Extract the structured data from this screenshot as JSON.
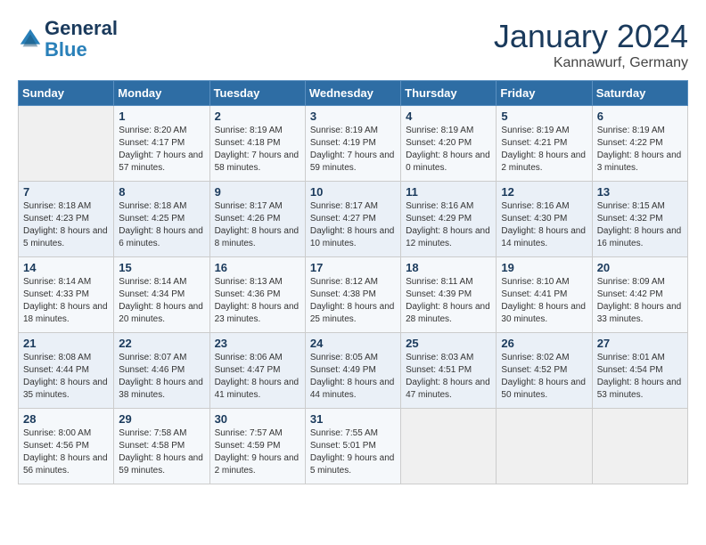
{
  "header": {
    "logo_line1": "General",
    "logo_line2": "Blue",
    "month_year": "January 2024",
    "location": "Kannawurf, Germany"
  },
  "days_of_week": [
    "Sunday",
    "Monday",
    "Tuesday",
    "Wednesday",
    "Thursday",
    "Friday",
    "Saturday"
  ],
  "weeks": [
    [
      {
        "day": "",
        "empty": true
      },
      {
        "day": "1",
        "sunrise": "8:20 AM",
        "sunset": "4:17 PM",
        "daylight": "7 hours and 57 minutes."
      },
      {
        "day": "2",
        "sunrise": "8:19 AM",
        "sunset": "4:18 PM",
        "daylight": "7 hours and 58 minutes."
      },
      {
        "day": "3",
        "sunrise": "8:19 AM",
        "sunset": "4:19 PM",
        "daylight": "7 hours and 59 minutes."
      },
      {
        "day": "4",
        "sunrise": "8:19 AM",
        "sunset": "4:20 PM",
        "daylight": "8 hours and 0 minutes."
      },
      {
        "day": "5",
        "sunrise": "8:19 AM",
        "sunset": "4:21 PM",
        "daylight": "8 hours and 2 minutes."
      },
      {
        "day": "6",
        "sunrise": "8:19 AM",
        "sunset": "4:22 PM",
        "daylight": "8 hours and 3 minutes."
      }
    ],
    [
      {
        "day": "7",
        "sunrise": "8:18 AM",
        "sunset": "4:23 PM",
        "daylight": "8 hours and 5 minutes."
      },
      {
        "day": "8",
        "sunrise": "8:18 AM",
        "sunset": "4:25 PM",
        "daylight": "8 hours and 6 minutes."
      },
      {
        "day": "9",
        "sunrise": "8:17 AM",
        "sunset": "4:26 PM",
        "daylight": "8 hours and 8 minutes."
      },
      {
        "day": "10",
        "sunrise": "8:17 AM",
        "sunset": "4:27 PM",
        "daylight": "8 hours and 10 minutes."
      },
      {
        "day": "11",
        "sunrise": "8:16 AM",
        "sunset": "4:29 PM",
        "daylight": "8 hours and 12 minutes."
      },
      {
        "day": "12",
        "sunrise": "8:16 AM",
        "sunset": "4:30 PM",
        "daylight": "8 hours and 14 minutes."
      },
      {
        "day": "13",
        "sunrise": "8:15 AM",
        "sunset": "4:32 PM",
        "daylight": "8 hours and 16 minutes."
      }
    ],
    [
      {
        "day": "14",
        "sunrise": "8:14 AM",
        "sunset": "4:33 PM",
        "daylight": "8 hours and 18 minutes."
      },
      {
        "day": "15",
        "sunrise": "8:14 AM",
        "sunset": "4:34 PM",
        "daylight": "8 hours and 20 minutes."
      },
      {
        "day": "16",
        "sunrise": "8:13 AM",
        "sunset": "4:36 PM",
        "daylight": "8 hours and 23 minutes."
      },
      {
        "day": "17",
        "sunrise": "8:12 AM",
        "sunset": "4:38 PM",
        "daylight": "8 hours and 25 minutes."
      },
      {
        "day": "18",
        "sunrise": "8:11 AM",
        "sunset": "4:39 PM",
        "daylight": "8 hours and 28 minutes."
      },
      {
        "day": "19",
        "sunrise": "8:10 AM",
        "sunset": "4:41 PM",
        "daylight": "8 hours and 30 minutes."
      },
      {
        "day": "20",
        "sunrise": "8:09 AM",
        "sunset": "4:42 PM",
        "daylight": "8 hours and 33 minutes."
      }
    ],
    [
      {
        "day": "21",
        "sunrise": "8:08 AM",
        "sunset": "4:44 PM",
        "daylight": "8 hours and 35 minutes."
      },
      {
        "day": "22",
        "sunrise": "8:07 AM",
        "sunset": "4:46 PM",
        "daylight": "8 hours and 38 minutes."
      },
      {
        "day": "23",
        "sunrise": "8:06 AM",
        "sunset": "4:47 PM",
        "daylight": "8 hours and 41 minutes."
      },
      {
        "day": "24",
        "sunrise": "8:05 AM",
        "sunset": "4:49 PM",
        "daylight": "8 hours and 44 minutes."
      },
      {
        "day": "25",
        "sunrise": "8:03 AM",
        "sunset": "4:51 PM",
        "daylight": "8 hours and 47 minutes."
      },
      {
        "day": "26",
        "sunrise": "8:02 AM",
        "sunset": "4:52 PM",
        "daylight": "8 hours and 50 minutes."
      },
      {
        "day": "27",
        "sunrise": "8:01 AM",
        "sunset": "4:54 PM",
        "daylight": "8 hours and 53 minutes."
      }
    ],
    [
      {
        "day": "28",
        "sunrise": "8:00 AM",
        "sunset": "4:56 PM",
        "daylight": "8 hours and 56 minutes."
      },
      {
        "day": "29",
        "sunrise": "7:58 AM",
        "sunset": "4:58 PM",
        "daylight": "8 hours and 59 minutes."
      },
      {
        "day": "30",
        "sunrise": "7:57 AM",
        "sunset": "4:59 PM",
        "daylight": "9 hours and 2 minutes."
      },
      {
        "day": "31",
        "sunrise": "7:55 AM",
        "sunset": "5:01 PM",
        "daylight": "9 hours and 5 minutes."
      },
      {
        "day": "",
        "empty": true
      },
      {
        "day": "",
        "empty": true
      },
      {
        "day": "",
        "empty": true
      }
    ]
  ]
}
